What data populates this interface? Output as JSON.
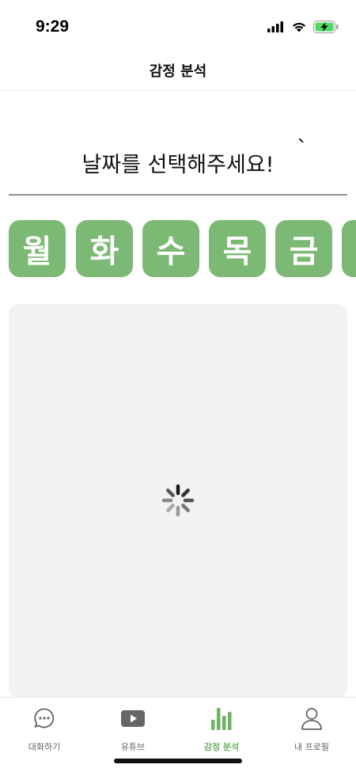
{
  "status_bar": {
    "time": "9:29",
    "icons": [
      "signal-icon",
      "wifi-icon",
      "battery-charging-icon"
    ]
  },
  "header": {
    "title": "감정 분석"
  },
  "date_select": {
    "placeholder": "날짜를 선택해주세요!",
    "caret": "`"
  },
  "days": [
    {
      "label": "월"
    },
    {
      "label": "화"
    },
    {
      "label": "수"
    },
    {
      "label": "목"
    },
    {
      "label": "금"
    },
    {
      "label": ""
    }
  ],
  "chart_card": {
    "state": "loading",
    "icon": "loading-spinner-icon"
  },
  "tab_bar": {
    "items": [
      {
        "label": "대화하기",
        "icon": "chat-bubble-icon",
        "active": false
      },
      {
        "label": "유튜브",
        "icon": "youtube-play-icon",
        "active": false
      },
      {
        "label": "감정 분석",
        "icon": "bar-chart-icon",
        "active": true
      },
      {
        "label": "내 프로필",
        "icon": "profile-icon",
        "active": false
      }
    ]
  },
  "colors": {
    "accent_green": "#7cb974",
    "active_tab": "#6fb165",
    "inactive_tab": "#666666",
    "card_bg": "#f2f2f2"
  }
}
